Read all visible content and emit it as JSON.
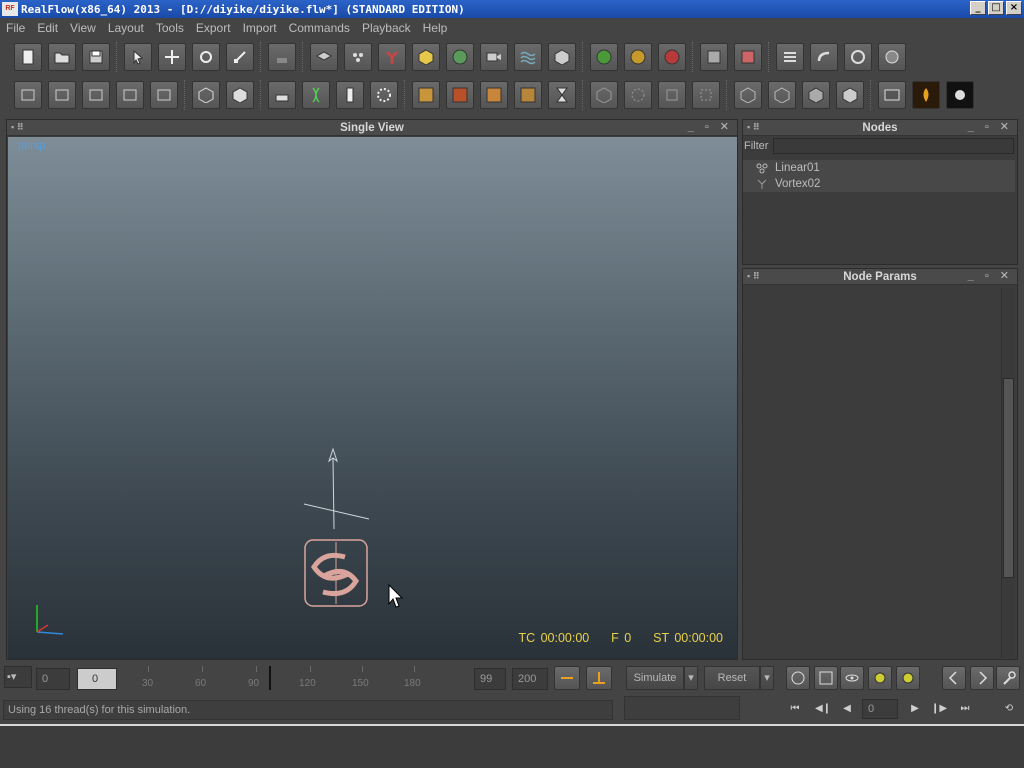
{
  "window": {
    "title": "RealFlow(x86_64) 2013 - [D://diyike/diyike.flw*] (STANDARD EDITION)",
    "app_icon_label": "RF",
    "controls": [
      "_",
      "□",
      "×"
    ]
  },
  "menu": [
    "File",
    "Edit",
    "View",
    "Layout",
    "Tools",
    "Export",
    "Import",
    "Commands",
    "Playback",
    "Help"
  ],
  "viewport": {
    "title": "Single View",
    "camera_label": "persp",
    "tc": "TC 00:00:00",
    "frame": "F 0",
    "st": "ST 00:00:00"
  },
  "nodes_panel": {
    "title": "Nodes",
    "filter_label": "Filter",
    "filter_value": "",
    "items": [
      {
        "label": "Linear01",
        "icon": "linear-daemon-icon"
      },
      {
        "label": "Vortex02",
        "icon": "vortex-daemon-icon"
      }
    ]
  },
  "params_panel": {
    "title": "Node Params"
  },
  "timeline": {
    "start_field": "0",
    "current_field": "0",
    "end_field": "99",
    "max_field": "200",
    "ticks": [
      "30",
      "60",
      "90",
      "120",
      "150",
      "180"
    ],
    "simulate_label": "Simulate",
    "reset_label": "Reset",
    "frame_field": "0"
  },
  "status": {
    "message": "Using 16 thread(s) for this simulation."
  },
  "toolbar_icons": {
    "row1": [
      "new-scene-icon",
      "open-scene-icon",
      "save-scene-icon",
      "select-icon",
      "move-icon",
      "rotate-icon",
      "scale-icon",
      "import-object-icon",
      "plane-icon",
      "particles-icon",
      "daemon-icon",
      "box-object-icon",
      "mesh-icon",
      "camera-icon",
      "realwave-icon",
      "grid-domain-icon",
      "green-sphere-icon",
      "yellow-sphere-icon",
      "red-sphere-icon",
      "export-icon",
      "export-red-icon",
      "batch-icon",
      "script-icon",
      "timer-icon",
      "render-icon"
    ],
    "row2": [
      "layout-1-icon",
      "layout-2-icon",
      "layout-3-icon",
      "layout-4-icon",
      "layout-5-icon",
      "cube-wire-icon",
      "cube-solid-icon",
      "emitter-icon",
      "dna-icon",
      "ruler-icon",
      "dots-icon",
      "texture-1-icon",
      "texture-2-icon",
      "texture-3-icon",
      "texture-4-icon",
      "hourglass-icon",
      "view-1-icon",
      "view-2-icon",
      "view-3-icon",
      "view-4-icon",
      "cube-1-icon",
      "cube-2-icon",
      "cube-3-icon",
      "cube-4-icon",
      "preview-icon",
      "fire-icon",
      "maxwell-icon"
    ]
  },
  "colors": {
    "accent_yellow": "#e8d24a",
    "persp_blue": "#5a9ed8",
    "title_blue": "#1a4aa8"
  }
}
